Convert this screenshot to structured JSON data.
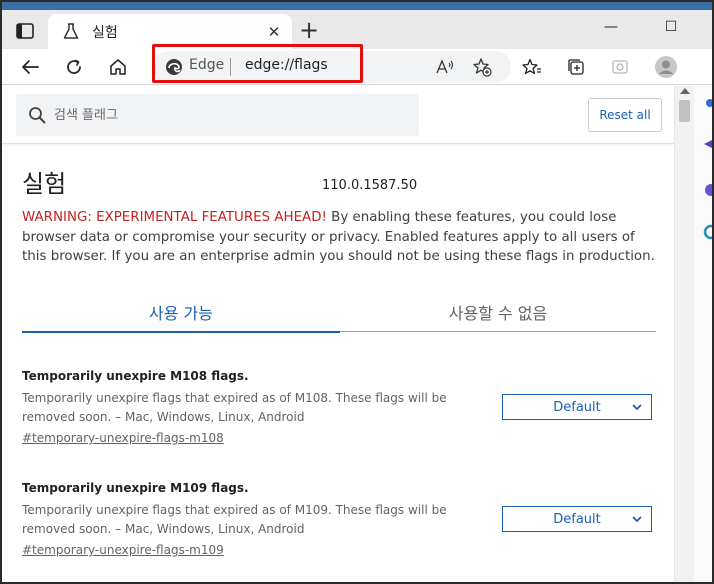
{
  "window": {
    "tab_title": "실험",
    "close_glyph": "✕",
    "newtab_glyph": "+",
    "minimize_glyph": "—",
    "restore_glyph": "☐",
    "close_window_glyph": "✕"
  },
  "address_bar": {
    "brand_label": "Edge",
    "url": "edge://flags"
  },
  "page": {
    "search_placeholder": "검색 플래그",
    "reset_label": "Reset all",
    "heading": "실험",
    "version": "110.0.1587.50",
    "warning_red": "WARNING: EXPERIMENTAL FEATURES AHEAD!",
    "warning_text": " By enabling these features, you could lose browser data or compromise your security or privacy. Enabled features apply to all users of this browser. If you are an enterprise admin you should not be using these flags in production.",
    "tabs": {
      "available": "사용 가능",
      "unavailable": "사용할 수 없음"
    },
    "flags": [
      {
        "title": "Temporarily unexpire M108 flags.",
        "description": "Temporarily unexpire flags that expired as of M108. These flags will be removed soon. – Mac, Windows, Linux, Android",
        "link": "#temporary-unexpire-flags-m108",
        "selected": "Default"
      },
      {
        "title": "Temporarily unexpire M109 flags.",
        "description": "Temporarily unexpire flags that expired as of M109. These flags will be removed soon. – Mac, Windows, Linux, Android",
        "link": "#temporary-unexpire-flags-m109",
        "selected": "Default"
      }
    ]
  },
  "colors": {
    "accent": "#1a5fb4",
    "warning": "#c5221f",
    "highlight_box": "#e01010"
  }
}
